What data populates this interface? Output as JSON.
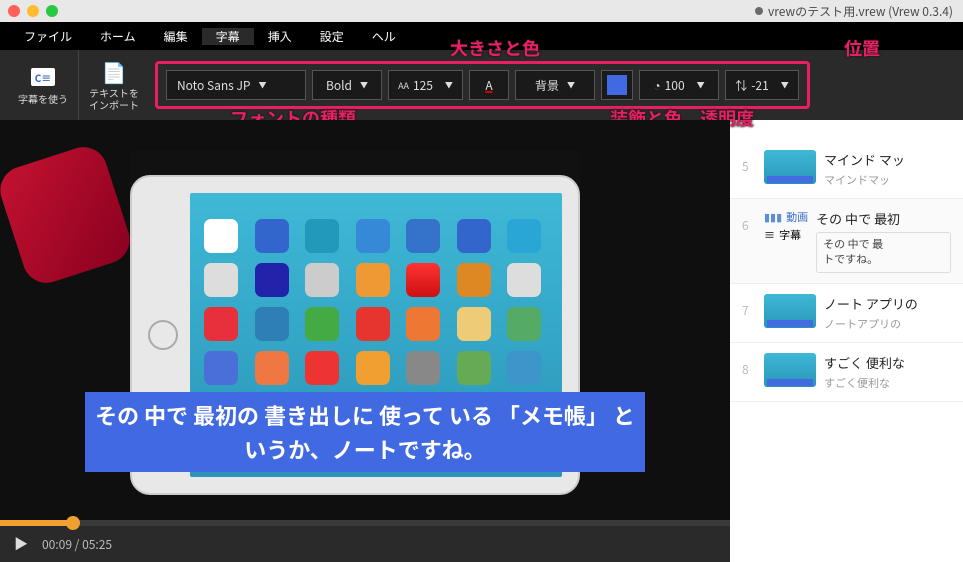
{
  "window": {
    "title": "vrewのテスト用.vrew (Vrew 0.3.4)"
  },
  "menu": {
    "items": [
      "ファイル",
      "ホーム",
      "編集",
      "字幕",
      "挿入",
      "設定",
      "ヘル"
    ]
  },
  "toolbar": {
    "use_subtitle": "字幕を使う",
    "import_text": "テキストを\nインポート",
    "font_family": "Noto Sans JP",
    "font_weight": "Bold",
    "font_size": "125",
    "size_prefix": "AA",
    "color_glyph": "A",
    "background_label": "背景",
    "opacity_value": "100",
    "position_value": "-21"
  },
  "annotations": {
    "size_color": "大きさと色",
    "position": "位置",
    "font_type": "フォントの種類",
    "decoration": "装飾と色、透明度"
  },
  "subtitle": {
    "text": "その 中で 最初の 書き出しに 使って いる 「メモ帳」 と\nいうか、ノートですね。"
  },
  "playback": {
    "current": "00:09",
    "total": "05:25"
  },
  "clips": [
    {
      "num": "5",
      "title": "マインド マッ",
      "desc": "マインドマッ"
    },
    {
      "num": "6",
      "type": "expanded",
      "line1": "その 中で 最初",
      "video_label": "動画",
      "subtitle_label": "字幕",
      "boxed": "その 中で 最\nトですね。"
    },
    {
      "num": "7",
      "title": "ノート アプリの",
      "desc": "ノートアプリの"
    },
    {
      "num": "8",
      "title": "すごく 便利な",
      "desc": "すごく便利な"
    }
  ]
}
